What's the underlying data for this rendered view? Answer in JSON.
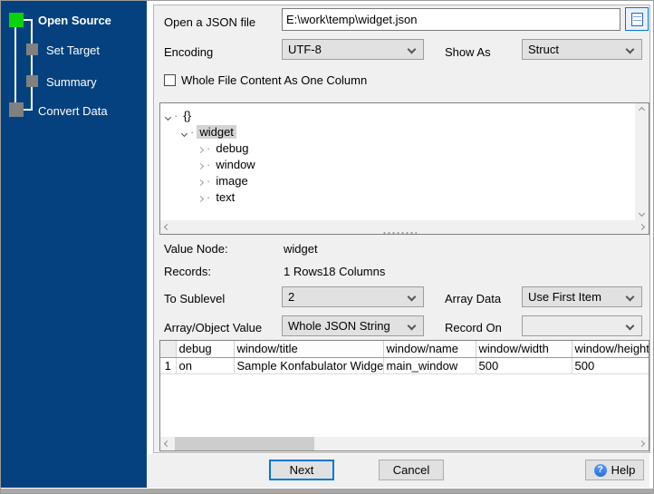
{
  "colors": {
    "sidebar_bg": "#05417e",
    "step_active": "#0bd20b",
    "step_inactive": "#808080",
    "focus_accent": "#0078d7",
    "panel_bg": "#f0f0f0",
    "tree_selection_bg": "#d3d3d3"
  },
  "sidebar": {
    "steps": [
      {
        "label": "Open Source",
        "state": "active"
      },
      {
        "label": "Set Target",
        "state": "pending"
      },
      {
        "label": "Summary",
        "state": "pending"
      },
      {
        "label": "Convert Data",
        "state": "pending"
      }
    ]
  },
  "form": {
    "file_label": "Open a JSON file",
    "file_value": "E:\\work\\temp\\widget.json",
    "browse_icon": "document-icon",
    "encoding_label": "Encoding",
    "encoding_value": "UTF-8",
    "show_as_label": "Show As",
    "show_as_value": "Struct",
    "checkbox_label": "Whole File Content As One Column",
    "checkbox_checked": false
  },
  "tree": {
    "items": [
      {
        "label": "{}",
        "level": 0,
        "expanded": true,
        "selected": false
      },
      {
        "label": "widget",
        "level": 1,
        "expanded": true,
        "selected": true
      },
      {
        "label": "debug",
        "level": 2,
        "expanded": false,
        "selected": false
      },
      {
        "label": "window",
        "level": 2,
        "expanded": false,
        "selected": false
      },
      {
        "label": "image",
        "level": 2,
        "expanded": false,
        "selected": false
      },
      {
        "label": "text",
        "level": 2,
        "expanded": false,
        "selected": false
      }
    ]
  },
  "info": {
    "value_node_label": "Value Node:",
    "value_node_value": "widget",
    "records_label": "Records:",
    "records_rows": "1 Rows",
    "records_columns": "18 Columns",
    "to_sublevel_label": "To Sublevel",
    "to_sublevel_value": "2",
    "array_data_label": "Array Data",
    "array_data_value": "Use First Item",
    "array_object_label": "Array/Object Value",
    "array_object_value": "Whole JSON String",
    "record_on_label": "Record On",
    "record_on_value": ""
  },
  "table": {
    "columns": [
      "debug",
      "window/title",
      "window/name",
      "window/width",
      "window/height"
    ],
    "rows": [
      {
        "num": "1",
        "cells": [
          "on",
          "Sample Konfabulator Widget",
          "main_window",
          "500",
          "500"
        ]
      }
    ]
  },
  "buttons": {
    "next": "Next",
    "cancel": "Cancel",
    "help": "Help",
    "help_icon": "question-circle-icon"
  }
}
